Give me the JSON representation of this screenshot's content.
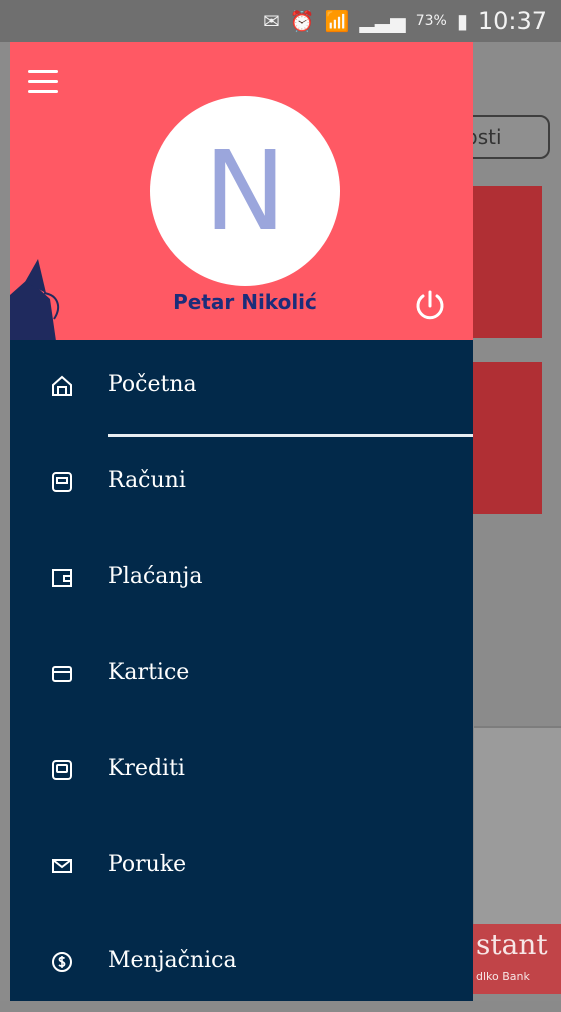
{
  "status_bar": {
    "battery_percent": "73%",
    "time": "10:37",
    "icons": [
      "no-sim-icon",
      "alarm-icon",
      "wifi-icon",
      "signal-icon",
      "battery-icon"
    ]
  },
  "background": {
    "button_label": "psti",
    "brand_text": "stant",
    "brand_subtext": "dlko Bank",
    "brand_color": "#b02f34"
  },
  "drawer": {
    "avatar_initial": "N",
    "user_name": "Petar Nikolić",
    "header_color": "#ff5964",
    "body_color": "#02294a",
    "items": [
      {
        "label": "Početna",
        "icon": "home-icon"
      },
      {
        "label": "Računi",
        "icon": "accounts-icon"
      },
      {
        "label": "Plaćanja",
        "icon": "wallet-icon"
      },
      {
        "label": "Kartice",
        "icon": "card-icon"
      },
      {
        "label": "Krediti",
        "icon": "loan-icon"
      },
      {
        "label": "Poruke",
        "icon": "mail-icon"
      },
      {
        "label": "Menjačnica",
        "icon": "currency-icon"
      }
    ]
  }
}
